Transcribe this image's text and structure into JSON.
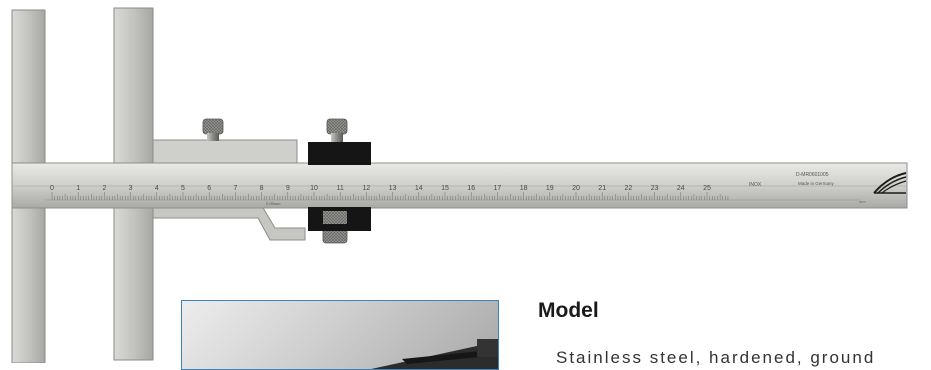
{
  "section": {
    "heading": "Model",
    "body_visible": "Stainless steel, hardened, ground"
  },
  "instrument": {
    "kind": "vernier depth gauge with measuring hook",
    "main_scale_numbers": [
      "0",
      "1",
      "2",
      "3",
      "4",
      "5",
      "6",
      "7",
      "8",
      "9",
      "10",
      "11",
      "12",
      "13",
      "14",
      "15",
      "16",
      "17",
      "18",
      "19",
      "20",
      "21",
      "22",
      "23",
      "24",
      "25"
    ],
    "beam_marking_line1": "INOX",
    "beam_marking_line2": "D-MR0601005",
    "beam_marking_line3": "Made in Germany",
    "vernier_label": "0.05mm",
    "unit_label": "mm",
    "colors": {
      "steel": "#c9c9c5",
      "steel_dark": "#8e8e8a",
      "jaw_black": "#151515",
      "frame_blue": "#3d83c0"
    }
  },
  "icons": [
    "logo-icon",
    "knurled-screw-icon"
  ]
}
